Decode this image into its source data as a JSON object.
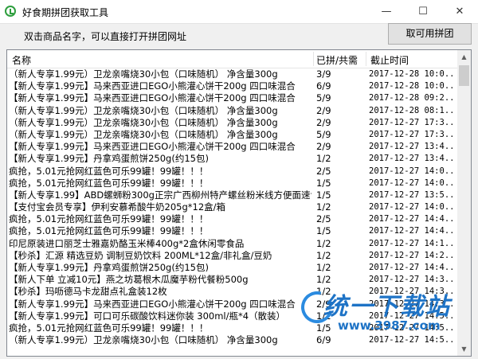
{
  "window": {
    "title": "好食期拼团获取工具",
    "minimize": "—",
    "maximize": "☐",
    "close": "✕"
  },
  "hint": "双击商品名字，可以直接打开拼团网址",
  "toolbar": {
    "available_button": "取可用拼团"
  },
  "columns": {
    "name": "名称",
    "count": "已拼/共需",
    "time": "截止时间"
  },
  "rows": [
    {
      "name": "（新人专享1.99元）卫龙亲嘴烧30小包（口味随机）  净含量300g",
      "count": "3/9",
      "time": "2017-12-28 10:0..."
    },
    {
      "name": "【新人专享1.99元】马来西亚进口EGO小熊灌心饼干200g 四口味混合",
      "count": "6/9",
      "time": "2017-12-28 10:0..."
    },
    {
      "name": "【新人专享1.99元】马来西亚进口EGO小熊灌心饼干200g 四口味混合",
      "count": "5/9",
      "time": "2017-12-28 09:2..."
    },
    {
      "name": "（新人专享1.99元）卫龙亲嘴烧30小包（口味随机）  净含量300g",
      "count": "2/9",
      "time": "2017-12-28 08:1..."
    },
    {
      "name": "（新人专享1.99元）卫龙亲嘴烧30小包（口味随机）  净含量300g",
      "count": "2/9",
      "time": "2017-12-27 17:3..."
    },
    {
      "name": "（新人专享1.99元）卫龙亲嘴烧30小包（口味随机）  净含量300g",
      "count": "5/9",
      "time": "2017-12-27 17:3..."
    },
    {
      "name": "【新人专享1.99元】马来西亚进口EGO小熊灌心饼干200g 四口味混合",
      "count": "2/9",
      "time": "2017-12-27 13:4..."
    },
    {
      "name": "【新人专享1.99元】丹拿鸡蛋煎饼250g(约15包)",
      "count": "1/2",
      "time": "2017-12-27 13:4..."
    },
    {
      "name": "疯抢，5.01元抢网红蓝色可乐99罐！99罐！！！",
      "count": "2/5",
      "time": "2017-12-27 14:0..."
    },
    {
      "name": "疯抢，5.01元抢网红蓝色可乐99罐！99罐！！！",
      "count": "1/5",
      "time": "2017-12-27 14:0..."
    },
    {
      "name": "【新人专享1.99】ABD螺蛳粉300g正宗广西柳州特产螺丝粉米线方便面速食",
      "count": "1/5",
      "time": "2017-12-27 13:5..."
    },
    {
      "name": "【支付宝会员专享】伊利安慕希酸牛奶205g*12盒/箱",
      "count": "1/2",
      "time": "2017-12-27 14:0..."
    },
    {
      "name": "疯抢，5.01元抢网红蓝色可乐99罐！99罐！！！",
      "count": "2/5",
      "time": "2017-12-27 14:4..."
    },
    {
      "name": "疯抢，5.01元抢网红蓝色可乐99罐！99罐！！！",
      "count": "1/5",
      "time": "2017-12-27 14:4..."
    },
    {
      "name": "印尼原装进口丽芝士雅嘉奶酪玉米棒400g*2盒休闲零食品",
      "count": "1/2",
      "time": "2017-12-27 14:1..."
    },
    {
      "name": "【秒杀】汇源 精选豆奶 调制豆奶饮料 200ML*12盒/非礼盒/豆奶",
      "count": "1/2",
      "time": "2017-12-27 14:2..."
    },
    {
      "name": "【新人专享1.99元】丹拿鸡蛋煎饼250g(约15包)",
      "count": "1/2",
      "time": "2017-12-27 14:4..."
    },
    {
      "name": "【新人下单 立减10元】燕之坊葛根木瓜魔芋粉代餐粉500g",
      "count": "1/2",
      "time": "2017-12-27 14:3..."
    },
    {
      "name": "【秒杀】玛呖德马卡龙甜点礼盒装12枚",
      "count": "1/2",
      "time": "2017-12-27 14:3..."
    },
    {
      "name": "【新人专享1.99元】马来西亚进口EGO小熊灌心饼干200g 四口味混合",
      "count": "2/9",
      "time": "2017-12-27 14:3..."
    },
    {
      "name": "【新人专享1.99元】可口可乐碳酸饮料迷你装 300ml/瓶*4（散装）",
      "count": "1/2",
      "time": "2017-12-27 14:5..."
    },
    {
      "name": "疯抢，5.01元抢网红蓝色可乐99罐！99罐！！！",
      "count": "1/5",
      "time": "2017-12-27 14:5..."
    },
    {
      "name": "（新人专享1.99元）卫龙亲嘴烧30小包（口味随机）  净含量300g",
      "count": "6/9",
      "time": "2017-12-27 14:5..."
    }
  ],
  "watermark": {
    "text": "统一下载站",
    "url": "www.3987.com"
  },
  "colors": {
    "watermark": "#1e73c6",
    "app_icon": "#2e9e3e"
  }
}
